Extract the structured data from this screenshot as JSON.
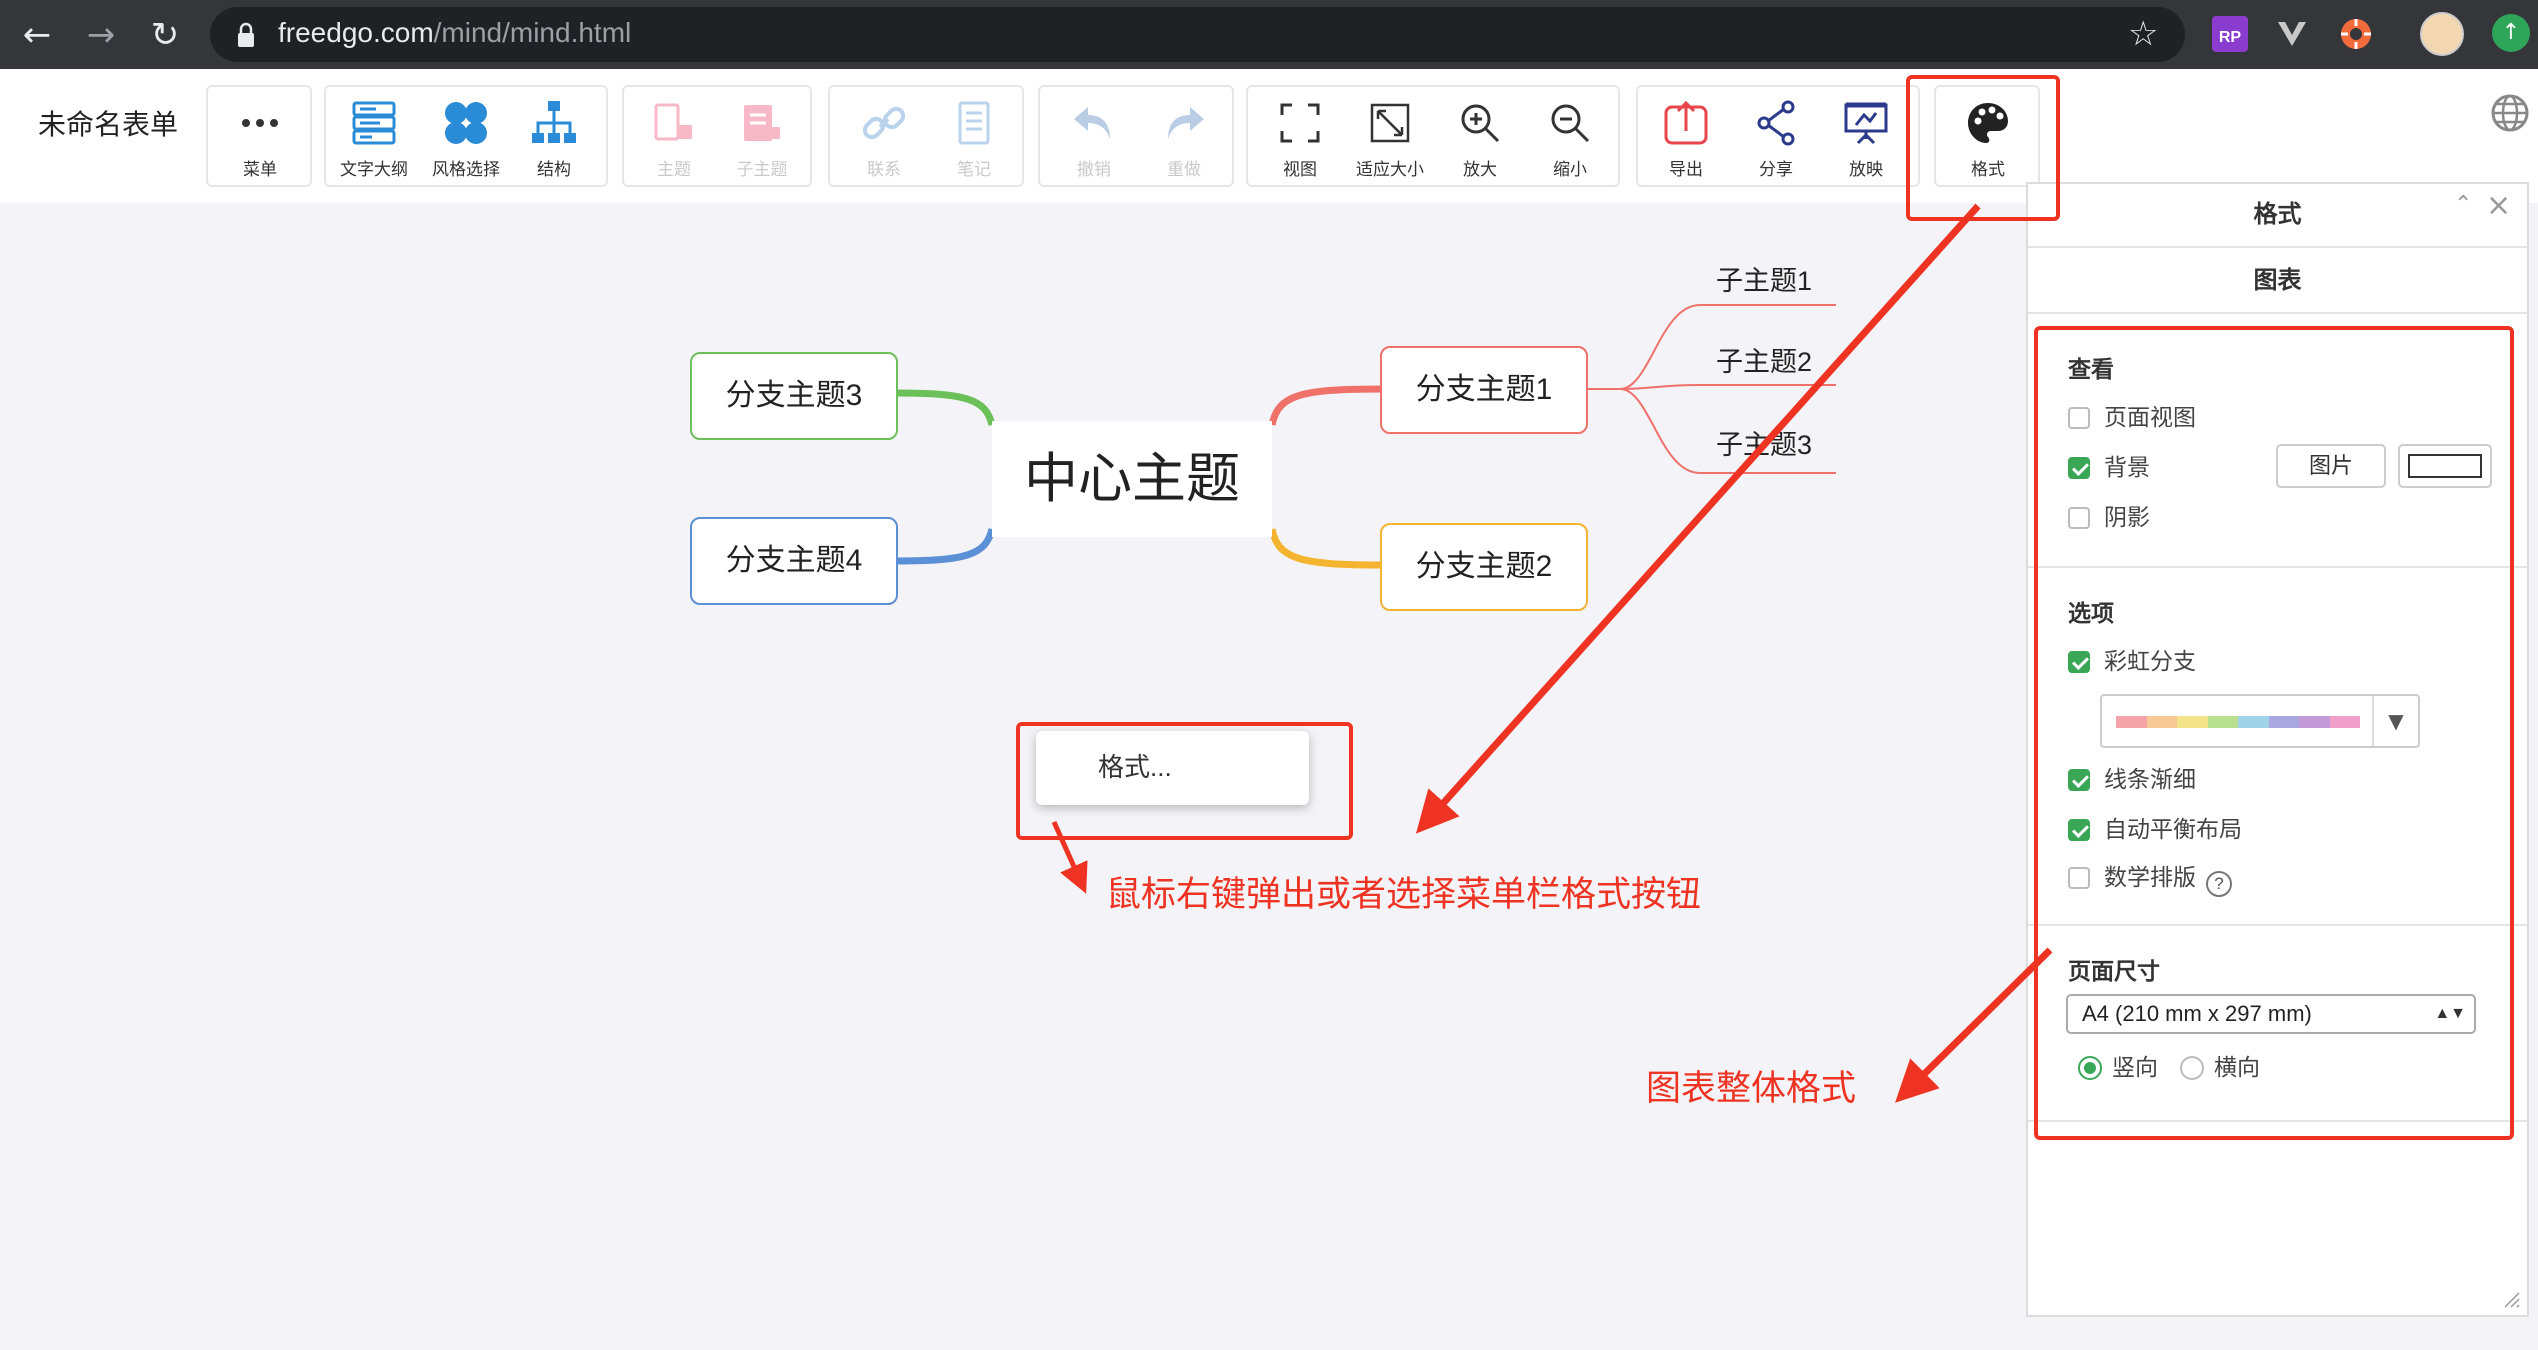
{
  "browser": {
    "url_host": "freedgo.com",
    "url_path": "/mind/mind.html",
    "ext_rp_label": "RP"
  },
  "app": {
    "doc_title": "未命名表单"
  },
  "toolbar": {
    "menu": "菜单",
    "outline": "文字大纲",
    "style": "风格选择",
    "structure": "结构",
    "topic": "主题",
    "subtopic": "子主题",
    "relation": "联系",
    "note": "笔记",
    "undo": "撤销",
    "redo": "重做",
    "view": "视图",
    "fit": "适应大小",
    "zoom_in": "放大",
    "zoom_out": "缩小",
    "export": "导出",
    "share": "分享",
    "present": "放映",
    "format": "格式"
  },
  "mindmap": {
    "center": "中心主题",
    "branches": [
      "分支主题1",
      "分支主题2",
      "分支主题3",
      "分支主题4"
    ],
    "subtopics": [
      "子主题1",
      "子主题2",
      "子主题3"
    ],
    "colors": {
      "branch1": "#f0706a",
      "branch2": "#f5b430",
      "branch3": "#6cc05a",
      "branch4": "#5b8fd6"
    }
  },
  "context_menu": {
    "item": "格式..."
  },
  "annotations": {
    "right_click": "鼠标右键弹出或者选择菜单栏格式按钮",
    "chart_format": "图表整体格式",
    "color": "#ee3322"
  },
  "panel": {
    "title": "格式",
    "tab": "图表",
    "view_section": "查看",
    "page_view": "页面视图",
    "background": "背景",
    "shadow": "阴影",
    "image_button": "图片",
    "options_section": "选项",
    "rainbow": "彩虹分支",
    "line_taper": "线条渐细",
    "auto_balance": "自动平衡布局",
    "math": "数学排版",
    "page_size_section": "页面尺寸",
    "page_size_value": "A4 (210 mm x 297 mm)",
    "portrait": "竖向",
    "landscape": "横向",
    "checked": {
      "page_view": false,
      "background": true,
      "shadow": false,
      "rainbow": true,
      "line_taper": true,
      "auto_balance": true,
      "math": false
    },
    "orientation": "portrait",
    "accent_color": "#3aa757",
    "rainbow_colors": [
      "#f4a3a8",
      "#f7c995",
      "#f3e38a",
      "#b8e08e",
      "#9ed3e8",
      "#a9a7e0",
      "#c29ad8",
      "#f0a0c8"
    ]
  }
}
